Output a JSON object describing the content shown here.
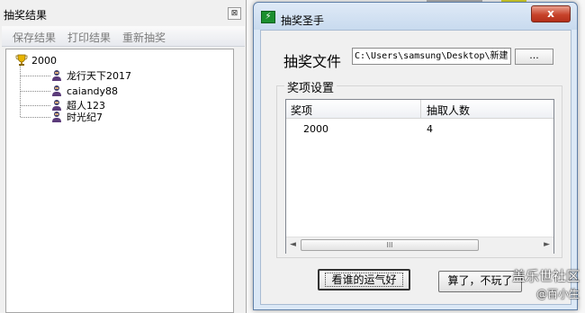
{
  "left_panel": {
    "title": "抽奖结果",
    "close_label": "⊠",
    "menu": [
      "保存结果",
      "打印结果",
      "重新抽奖"
    ],
    "tree": {
      "root": "2000",
      "children": [
        "龙行天下2017",
        "caiandy88",
        "超人123",
        "时光纪7"
      ]
    }
  },
  "dialog": {
    "title": "抽奖圣手",
    "close_label": "x",
    "file_label": "抽奖文件",
    "file_path": "C:\\Users\\samsung\\Desktop\\新建",
    "browse_label": "...",
    "group_title": "奖项设置",
    "columns": [
      "奖项",
      "抽取人数"
    ],
    "rows": [
      [
        "2000",
        "4"
      ]
    ],
    "scroll_thumb": "III",
    "btn_draw": "看谁的运气好",
    "btn_quit": "算了，不玩了"
  },
  "watermark": {
    "line1": "盖乐世社区",
    "line2": "@百小生"
  }
}
